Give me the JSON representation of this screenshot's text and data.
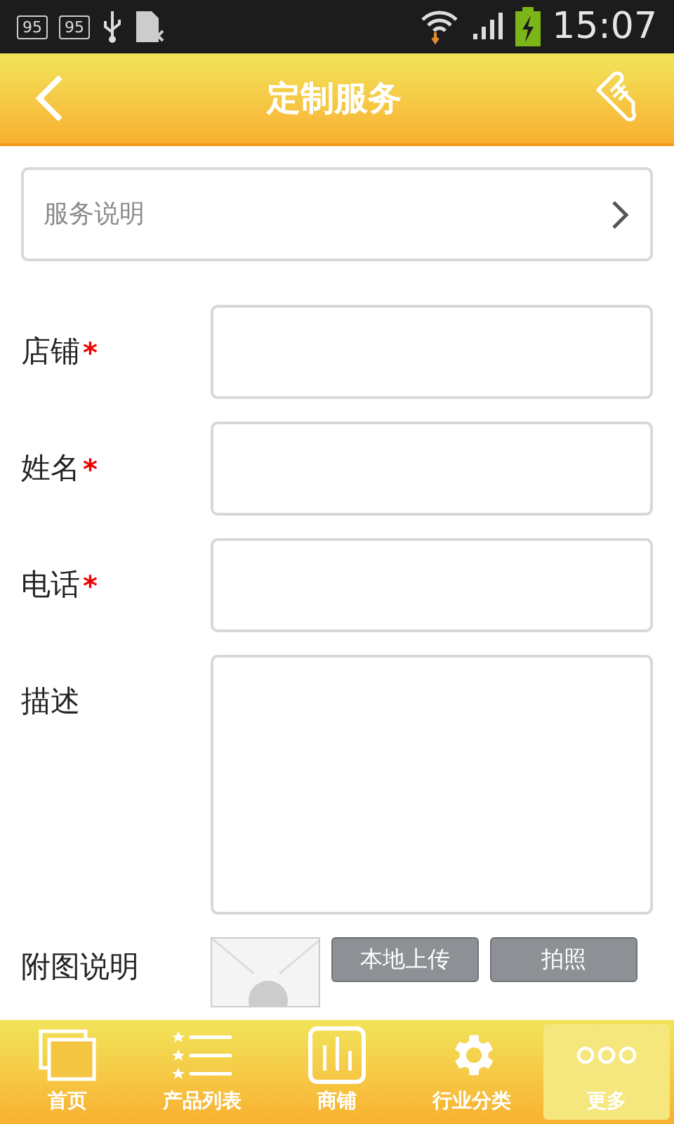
{
  "status_bar": {
    "badges": [
      "95",
      "95"
    ],
    "time": "15:07"
  },
  "header": {
    "title": "定制服务"
  },
  "service_row": {
    "label": "服务说明"
  },
  "fields": [
    {
      "kind": "input",
      "label": "店铺",
      "required": true
    },
    {
      "kind": "input",
      "label": "姓名",
      "required": true
    },
    {
      "kind": "input",
      "label": "电话",
      "required": true
    },
    {
      "kind": "textarea",
      "label": "描述",
      "required": false
    }
  ],
  "required_mark": "*",
  "attachment": {
    "label": "附图说明",
    "buttons": [
      "本地上传",
      "拍照"
    ]
  },
  "nav": [
    {
      "label": "首页",
      "selected": false
    },
    {
      "label": "产品列表",
      "selected": false
    },
    {
      "label": "商铺",
      "selected": false
    },
    {
      "label": "行业分类",
      "selected": false
    },
    {
      "label": "更多",
      "selected": true
    }
  ]
}
